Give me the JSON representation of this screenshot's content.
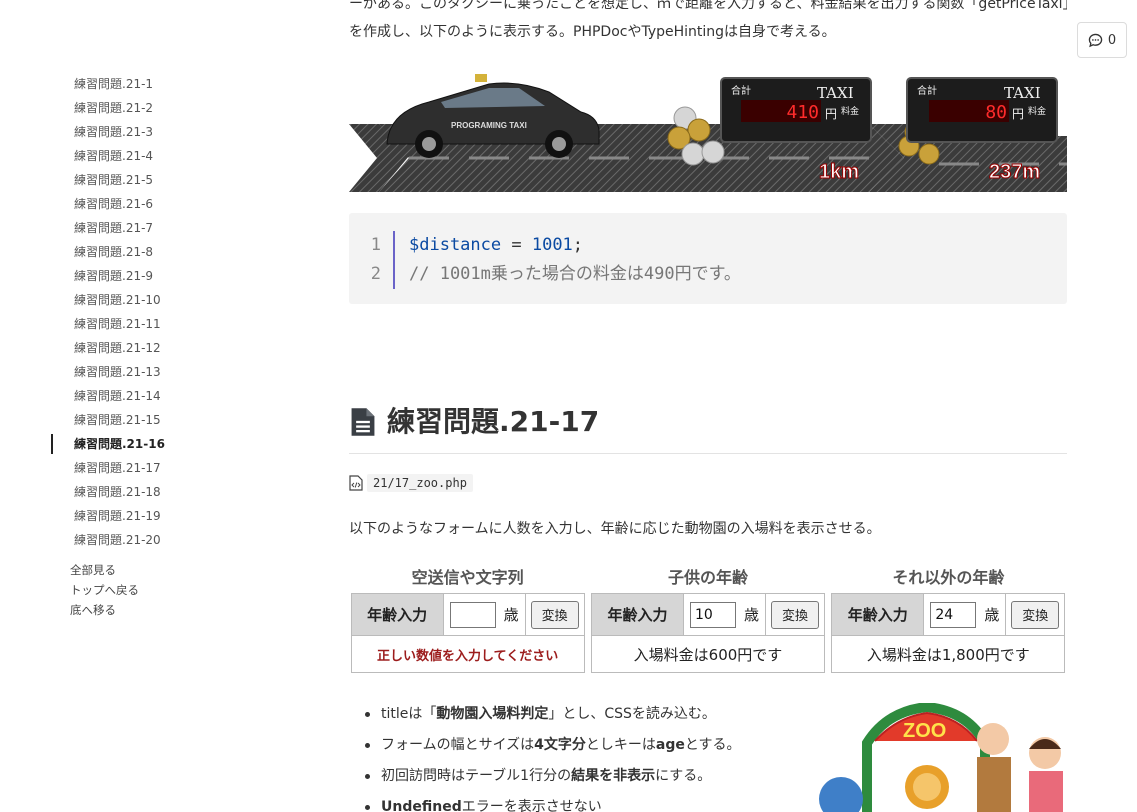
{
  "toc": {
    "items": [
      {
        "label": "練習問題.21-1",
        "active": false
      },
      {
        "label": "練習問題.21-2",
        "active": false
      },
      {
        "label": "練習問題.21-3",
        "active": false
      },
      {
        "label": "練習問題.21-4",
        "active": false
      },
      {
        "label": "練習問題.21-5",
        "active": false
      },
      {
        "label": "練習問題.21-6",
        "active": false
      },
      {
        "label": "練習問題.21-7",
        "active": false
      },
      {
        "label": "練習問題.21-8",
        "active": false
      },
      {
        "label": "練習問題.21-9",
        "active": false
      },
      {
        "label": "練習問題.21-10",
        "active": false
      },
      {
        "label": "練習問題.21-11",
        "active": false
      },
      {
        "label": "練習問題.21-12",
        "active": false
      },
      {
        "label": "練習問題.21-13",
        "active": false
      },
      {
        "label": "練習問題.21-14",
        "active": false
      },
      {
        "label": "練習問題.21-15",
        "active": false
      },
      {
        "label": "練習問題.21-16",
        "active": true
      },
      {
        "label": "練習問題.21-17",
        "active": false
      },
      {
        "label": "練習問題.21-18",
        "active": false
      },
      {
        "label": "練習問題.21-19",
        "active": false
      },
      {
        "label": "練習問題.21-20",
        "active": false
      }
    ],
    "links": {
      "view_all": "全部見る",
      "back_to_top": "トップへ戻る",
      "go_to_bottom": "底へ移る"
    }
  },
  "comment": {
    "count": "0"
  },
  "intro": {
    "line1": "ーがある。このタクシーに乗ったことを想定し、ｍで距離を入力すると、料金結果を出力する関数「getPriceTaxi」",
    "line2": "を作成し、以下のように表示する。PHPDocやTypeHintingは自身で考える。"
  },
  "banner": {
    "car_text": "PROGRAMING TAXI",
    "meters": [
      {
        "total_label": "合計",
        "brand": "TAXI",
        "amount": "410",
        "unit": "円",
        "fare_label": "料金",
        "distance": "1km"
      },
      {
        "total_label": "合計",
        "brand": "TAXI",
        "amount": "80",
        "unit": "円",
        "fare_label": "料金",
        "distance": "237m"
      }
    ]
  },
  "code": {
    "lines": [
      {
        "num": "1",
        "var": "$distance",
        "op": " = ",
        "num_val": "1001",
        "end": ";"
      },
      {
        "num": "2",
        "comment": "// 1001m乗った場合の料金は490円です。"
      }
    ]
  },
  "section": {
    "title": "練習問題.21-17",
    "file": "21/17_zoo.php",
    "description": "以下のようなフォームに人数を入力し、年齢に応じた動物園の入場料を表示させる。"
  },
  "demo": {
    "panels": [
      {
        "title": "空送信や文字列",
        "label": "年齢入力",
        "value": "",
        "unit": "歳",
        "button": "変換",
        "result": "正しい数値を入力してください",
        "error": true
      },
      {
        "title": "子供の年齢",
        "label": "年齢入力",
        "value": "10",
        "unit": "歳",
        "button": "変換",
        "result": "入場料金は600円です",
        "error": false
      },
      {
        "title": "それ以外の年齢",
        "label": "年齢入力",
        "value": "24",
        "unit": "歳",
        "button": "変換",
        "result": "入場料金は1,800円です",
        "error": false
      }
    ]
  },
  "bullets": [
    {
      "pre": "titleは「",
      "bold": "動物園入場料判定",
      "post": "」とし、CSSを読み込む。"
    },
    {
      "pre": "フォームの幅とサイズは",
      "bold": "4文字分",
      "post": "としキーは",
      "bold2": "age",
      "post2": "とする。"
    },
    {
      "pre": "初回訪問時はテーブル1行分の",
      "bold": "結果を非表示",
      "post": "にする。"
    },
    {
      "pre": "",
      "bold": "Undefined",
      "post": "エラーを表示させない"
    }
  ],
  "zoo": {
    "sign": "ZOO"
  },
  "colors": {
    "accent_bar": "#6a63c8",
    "error": "#9c1c1c"
  }
}
